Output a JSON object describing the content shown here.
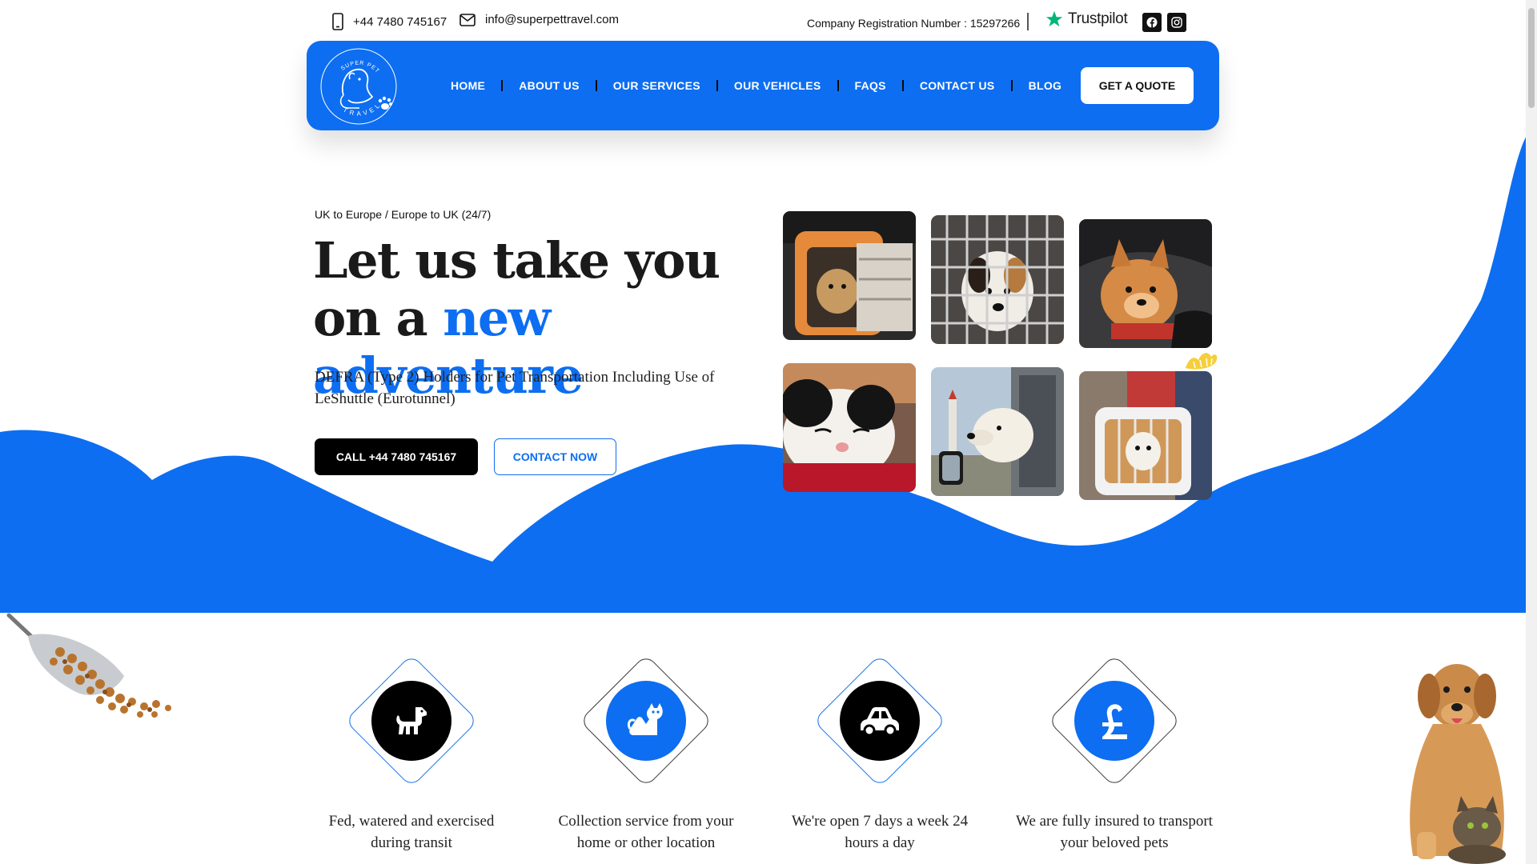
{
  "topbar": {
    "phone": "+44 7480 745167",
    "email": "info@superpettravel.com",
    "registration": "Company Registration Number : 15297266",
    "trustpilot": "Trustpilot"
  },
  "nav": {
    "logo_top_text": "SUPER PET",
    "logo_bottom_text": "TRAVEL",
    "items": [
      {
        "label": "HOME"
      },
      {
        "label": "ABOUT US"
      },
      {
        "label": "OUR SERVICES"
      },
      {
        "label": "OUR VEHICLES"
      },
      {
        "label": "FAQS"
      },
      {
        "label": "CONTACT US"
      },
      {
        "label": "BLOG"
      }
    ],
    "quote_button": "GET A QUOTE"
  },
  "hero": {
    "subtitle": "UK to Europe / Europe to UK (24/7)",
    "title_part1": "Let us take you on a ",
    "title_highlight": "new adventure",
    "description": "DEFRA (Type 2) Holders for Pet Transportation Including Use of LeShuttle (Eurotunnel)",
    "call_button": "CALL +44 7480 745167",
    "contact_button": "CONTACT NOW"
  },
  "features": [
    {
      "icon": "dog-icon",
      "label": "Fed, watered and exercised during transit"
    },
    {
      "icon": "cat-icon",
      "label": "Collection service from your home or other location"
    },
    {
      "icon": "car-icon",
      "label": "We're open 7 days a week 24 hours a day"
    },
    {
      "icon": "pound-icon",
      "label": "We are fully insured to transport your beloved pets"
    }
  ],
  "colors": {
    "brand_blue": "#0d6ef1",
    "black": "#000000"
  }
}
